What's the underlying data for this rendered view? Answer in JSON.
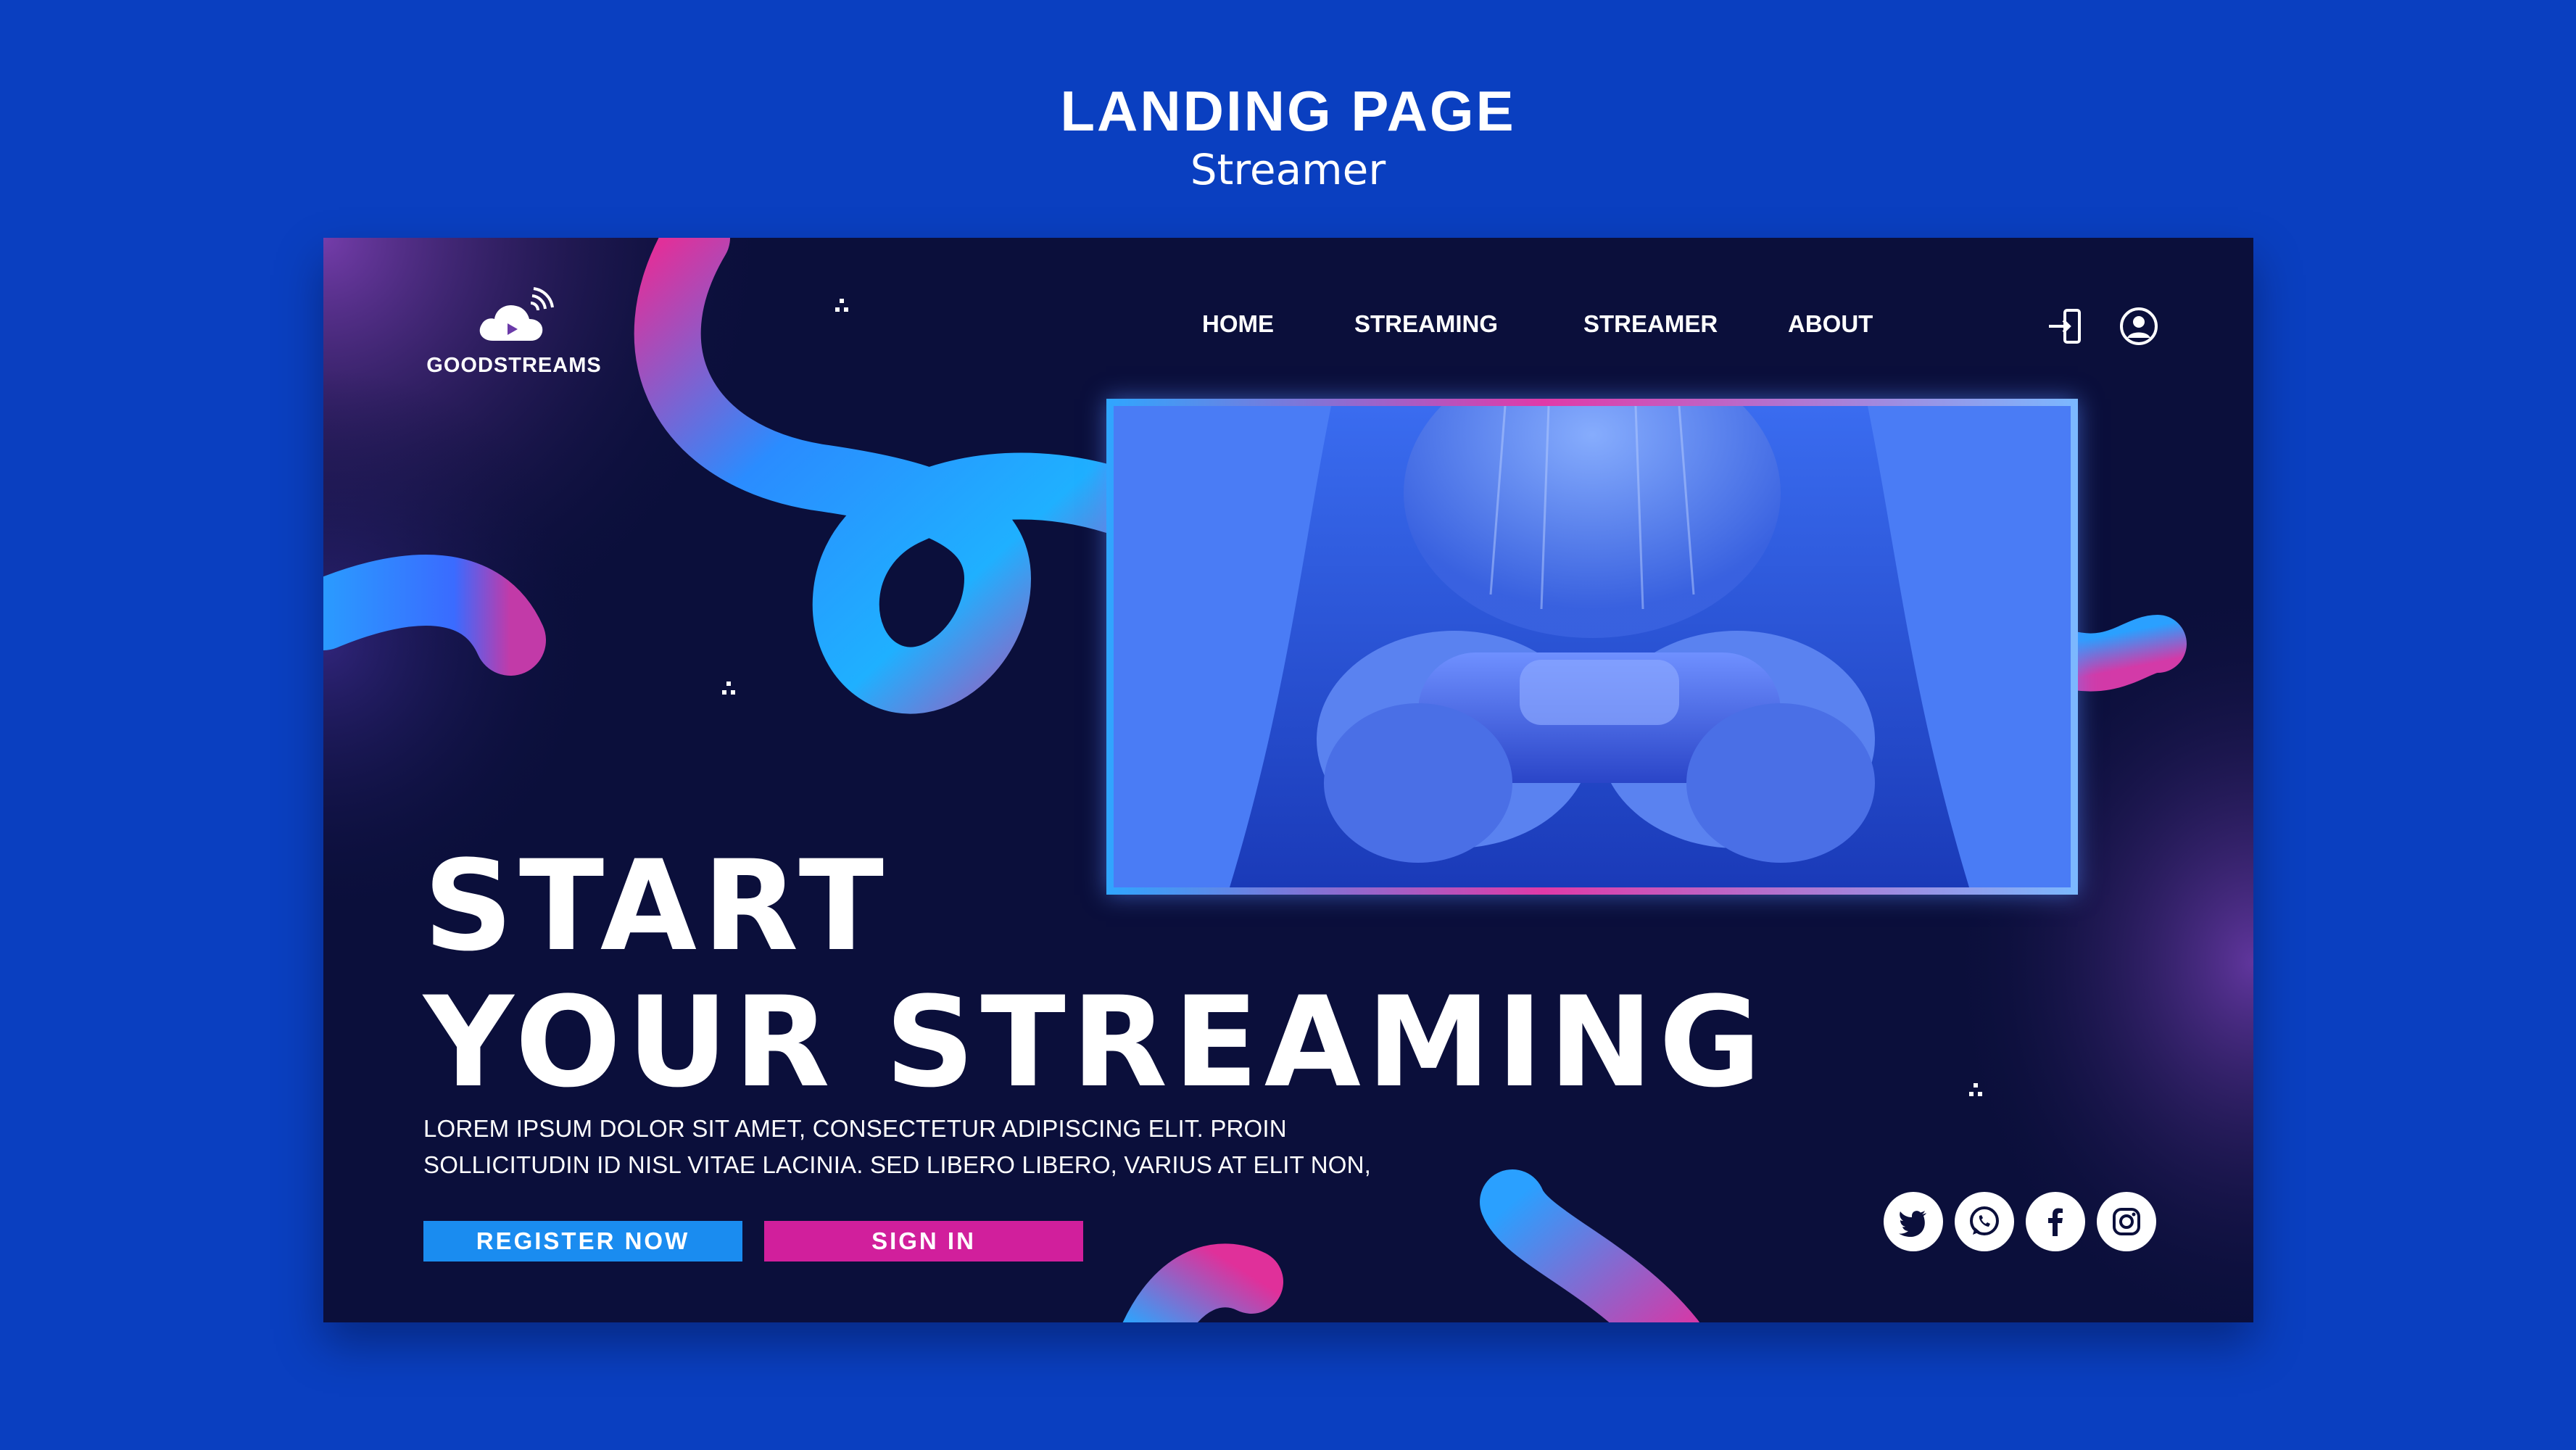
{
  "heading": {
    "title": "LANDING PAGE",
    "subtitle": "Streamer"
  },
  "brand": {
    "name": "GOODSTREAMS"
  },
  "nav": {
    "items": [
      {
        "label": "HOME"
      },
      {
        "label": "STREAMING"
      },
      {
        "label": "STREAMER"
      },
      {
        "label": "ABOUT"
      }
    ]
  },
  "header_icons": [
    "login-icon",
    "user-icon"
  ],
  "hero": {
    "line1": "START",
    "line2": "YOUR STREAMING",
    "description_line1": "LOREM IPSUM DOLOR SIT AMET, CONSECTETUR ADIPISCING ELIT. PROIN",
    "description_line2": "SOLLICITUDIN ID NISL VITAE LACINIA. SED LIBERO LIBERO, VARIUS AT ELIT NON,",
    "register_label": "REGISTER NOW",
    "signin_label": "SIGN IN"
  },
  "social": [
    "twitter-icon",
    "whatsapp-icon",
    "facebook-icon",
    "instagram-icon"
  ],
  "colors": {
    "page_background": "#0a3fc0",
    "card_background": "#0b0f3b",
    "register_button": "#1a8cf0",
    "signin_button": "#d11f9c",
    "accent_blue": "#2fa6ff",
    "accent_pink": "#e03aa8"
  }
}
